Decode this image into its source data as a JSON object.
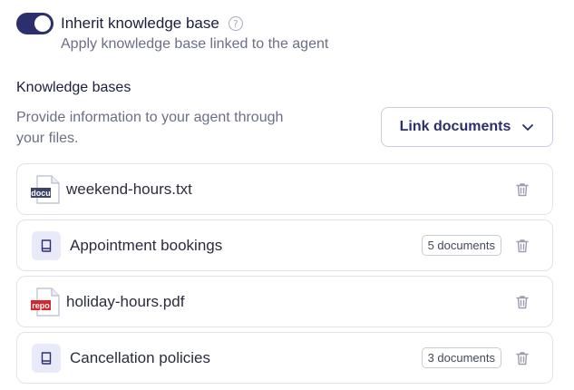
{
  "toggle": {
    "title": "Inherit knowledge base",
    "subtitle": "Apply knowledge base linked to the agent",
    "on": true,
    "help_icon": "question-circle-icon",
    "help_glyph": "?"
  },
  "knowledge": {
    "heading": "Knowledge bases",
    "description": "Provide information to your agent through your files.",
    "link_button": "Link documents"
  },
  "items": [
    {
      "type": "file",
      "icon": "doc-file-icon",
      "icon_tag": "docu",
      "tag_color": "#3d4466",
      "name": "weekend-hours.txt",
      "badge": ""
    },
    {
      "type": "collection",
      "icon": "book-icon",
      "name": "Appointment bookings",
      "badge": "5 documents"
    },
    {
      "type": "file",
      "icon": "pdf-file-icon",
      "icon_tag": "repo",
      "tag_color": "#d7262b",
      "name": "holiday-hours.pdf",
      "badge": ""
    },
    {
      "type": "collection",
      "icon": "book-icon",
      "name": "Cancellation policies",
      "badge": "3 documents"
    }
  ],
  "colors": {
    "toggle_on": "#2b2f6b",
    "book_bg": "#e9eaf9",
    "accent_text": "#2b2f6b"
  }
}
